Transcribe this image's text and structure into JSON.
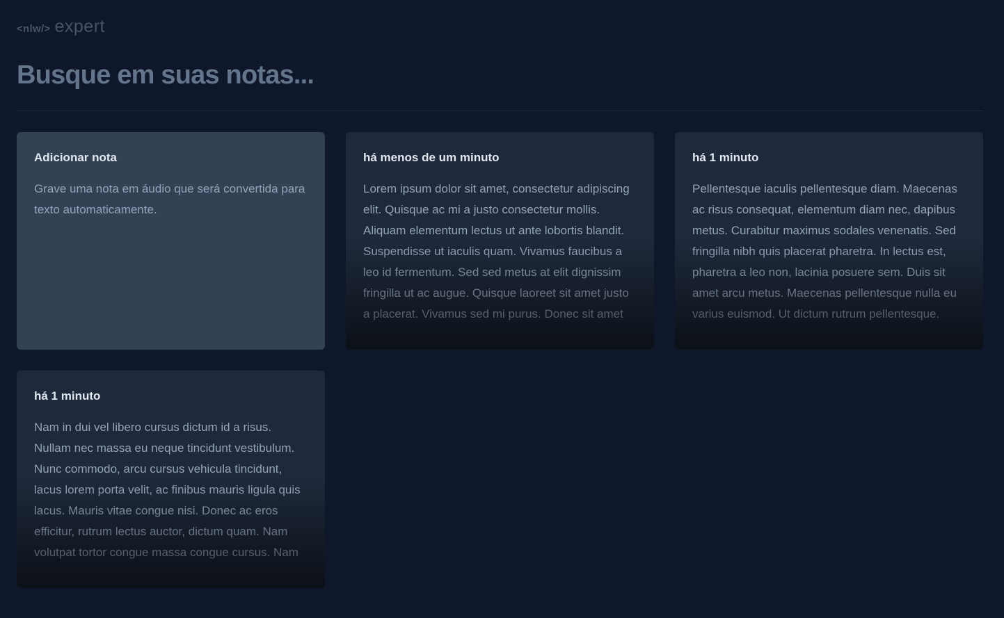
{
  "logo": {
    "nlw_text": "<nlw/>",
    "expert_text": "expert"
  },
  "search": {
    "placeholder": "Busque em suas notas...",
    "value": ""
  },
  "add_note": {
    "title": "Adicionar nota",
    "description": "Grave uma nota em áudio que será convertida para texto automaticamente."
  },
  "notes": [
    {
      "date": "há menos de um minuto",
      "content": "Lorem ipsum dolor sit amet, consectetur adipiscing elit. Quisque ac mi a justo consectetur mollis. Aliquam elementum lectus ut ante lobortis blandit. Suspendisse ut iaculis quam. Vivamus faucibus a leo id fermentum. Sed sed metus at elit dignissim fringilla ut ac augue. Quisque laoreet sit amet justo a placerat. Vivamus sed mi purus. Donec sit amet"
    },
    {
      "date": "há 1 minuto",
      "content": "Pellentesque iaculis pellentesque diam. Maecenas ac risus consequat, elementum diam nec, dapibus metus. Curabitur maximus sodales venenatis. Sed fringilla nibh quis placerat pharetra. In lectus est, pharetra a leo non, lacinia posuere sem. Duis sit amet arcu metus. Maecenas pellentesque nulla eu varius euismod. Ut dictum rutrum pellentesque."
    },
    {
      "date": "há 1 minuto",
      "content": "Nam in dui vel libero cursus dictum id a risus. Nullam nec massa eu neque tincidunt vestibulum. Nunc commodo, arcu cursus vehicula tincidunt, lacus lorem porta velit, ac finibus mauris ligula quis lacus. Mauris vitae congue nisi. Donec ac eros efficitur, rutrum lectus auctor, dictum quam. Nam volutpat tortor congue massa congue cursus. Nam"
    }
  ],
  "colors": {
    "background": "#0f172a",
    "card": "#1e293b",
    "add_card": "#334155",
    "placeholder": "#64748b",
    "body_text": "#94a3b8",
    "title_text": "#e2e8f0"
  }
}
